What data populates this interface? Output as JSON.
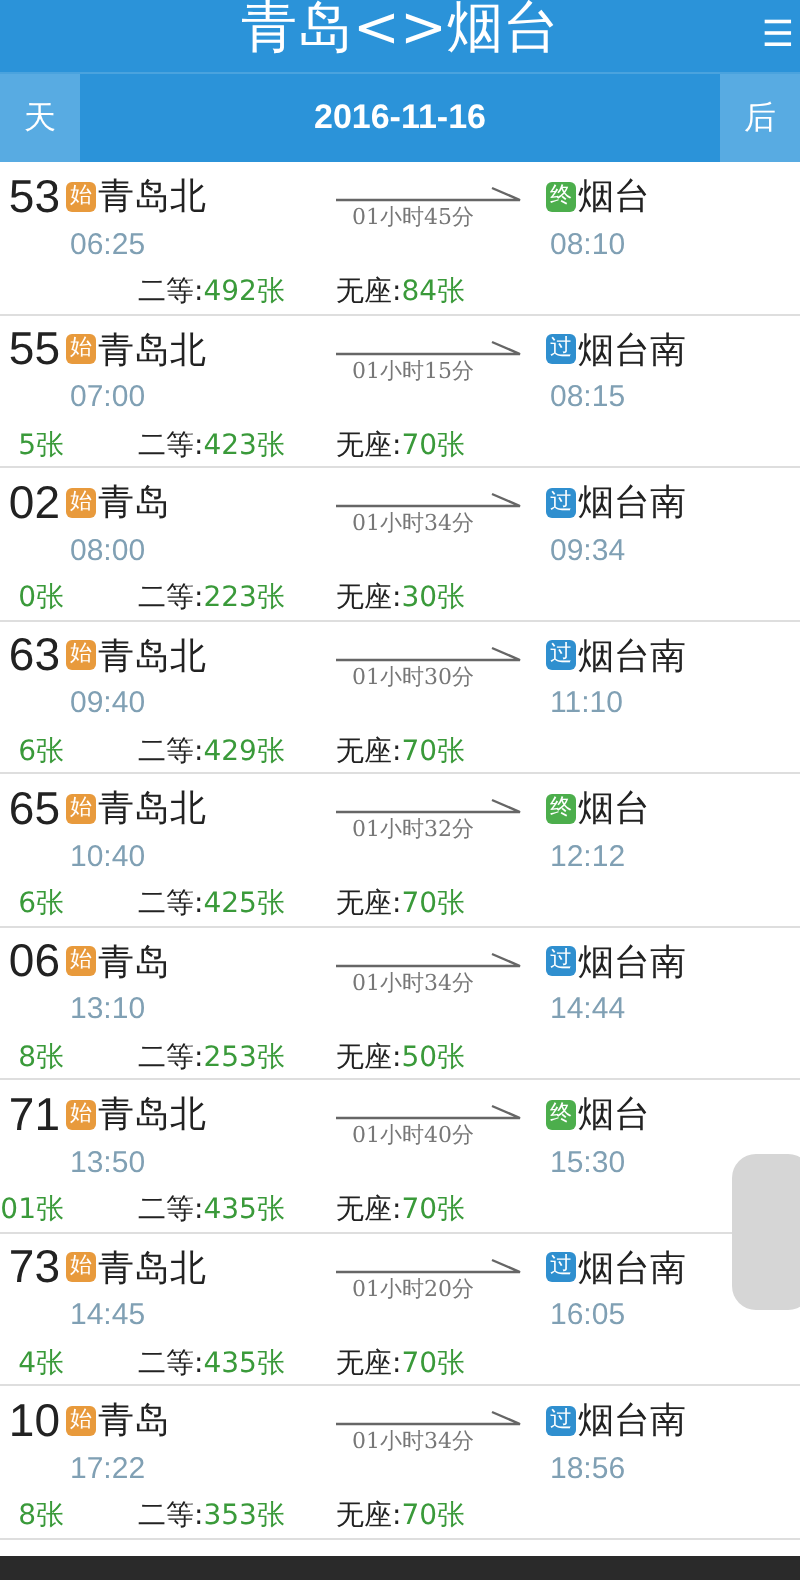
{
  "header": {
    "title": "青岛<>烟台",
    "menu_icon": "☰"
  },
  "date_bar": {
    "prev": "天",
    "date": "2016-11-16",
    "next": "后"
  },
  "trains": [
    {
      "number": "53",
      "origin": {
        "tag": "始",
        "color": "#e89a3c",
        "station": "青岛北",
        "time": "06:25"
      },
      "duration": "01小时45分",
      "destination": {
        "tag": "终",
        "color": "#4cae4c",
        "station": "烟台",
        "time": "08:10"
      },
      "seats": [
        {
          "label": "二等:",
          "count": "492张"
        },
        {
          "label": "无座:",
          "count": "84张"
        }
      ]
    },
    {
      "number": "55",
      "origin": {
        "tag": "始",
        "color": "#e89a3c",
        "station": "青岛北",
        "time": "07:00"
      },
      "duration": "01小时15分",
      "destination": {
        "tag": "过",
        "color": "#2f8fcf",
        "station": "烟台南",
        "time": "08:15"
      },
      "left_count": "5张",
      "seats": [
        {
          "label": "二等:",
          "count": "423张"
        },
        {
          "label": "无座:",
          "count": "70张"
        }
      ]
    },
    {
      "number": "02",
      "origin": {
        "tag": "始",
        "color": "#e89a3c",
        "station": "青岛",
        "time": "08:00"
      },
      "duration": "01小时34分",
      "destination": {
        "tag": "过",
        "color": "#2f8fcf",
        "station": "烟台南",
        "time": "09:34"
      },
      "left_count": "0张",
      "seats": [
        {
          "label": "二等:",
          "count": "223张"
        },
        {
          "label": "无座:",
          "count": "30张"
        }
      ]
    },
    {
      "number": "63",
      "origin": {
        "tag": "始",
        "color": "#e89a3c",
        "station": "青岛北",
        "time": "09:40"
      },
      "duration": "01小时30分",
      "destination": {
        "tag": "过",
        "color": "#2f8fcf",
        "station": "烟台南",
        "time": "11:10"
      },
      "left_count": "6张",
      "seats": [
        {
          "label": "二等:",
          "count": "429张"
        },
        {
          "label": "无座:",
          "count": "70张"
        }
      ]
    },
    {
      "number": "65",
      "origin": {
        "tag": "始",
        "color": "#e89a3c",
        "station": "青岛北",
        "time": "10:40"
      },
      "duration": "01小时32分",
      "destination": {
        "tag": "终",
        "color": "#4cae4c",
        "station": "烟台",
        "time": "12:12"
      },
      "left_count": "6张",
      "seats": [
        {
          "label": "二等:",
          "count": "425张"
        },
        {
          "label": "无座:",
          "count": "70张"
        }
      ]
    },
    {
      "number": "06",
      "origin": {
        "tag": "始",
        "color": "#e89a3c",
        "station": "青岛",
        "time": "13:10"
      },
      "duration": "01小时34分",
      "destination": {
        "tag": "过",
        "color": "#2f8fcf",
        "station": "烟台南",
        "time": "14:44"
      },
      "left_count": "8张",
      "seats": [
        {
          "label": "二等:",
          "count": "253张"
        },
        {
          "label": "无座:",
          "count": "50张"
        }
      ]
    },
    {
      "number": "71",
      "origin": {
        "tag": "始",
        "color": "#e89a3c",
        "station": "青岛北",
        "time": "13:50"
      },
      "duration": "01小时40分",
      "destination": {
        "tag": "终",
        "color": "#4cae4c",
        "station": "烟台",
        "time": "15:30"
      },
      "left_count": "01张",
      "seats": [
        {
          "label": "二等:",
          "count": "435张"
        },
        {
          "label": "无座:",
          "count": "70张"
        }
      ]
    },
    {
      "number": "73",
      "origin": {
        "tag": "始",
        "color": "#e89a3c",
        "station": "青岛北",
        "time": "14:45"
      },
      "duration": "01小时20分",
      "destination": {
        "tag": "过",
        "color": "#2f8fcf",
        "station": "烟台南",
        "time": "16:05"
      },
      "left_count": "4张",
      "seats": [
        {
          "label": "二等:",
          "count": "435张"
        },
        {
          "label": "无座:",
          "count": "70张"
        }
      ]
    },
    {
      "number": "10",
      "origin": {
        "tag": "始",
        "color": "#e89a3c",
        "station": "青岛",
        "time": "17:22"
      },
      "duration": "01小时34分",
      "destination": {
        "tag": "过",
        "color": "#2f8fcf",
        "station": "烟台南",
        "time": "18:56"
      },
      "left_count": "8张",
      "seats": [
        {
          "label": "二等:",
          "count": "353张"
        },
        {
          "label": "无座:",
          "count": "70张"
        }
      ]
    }
  ]
}
